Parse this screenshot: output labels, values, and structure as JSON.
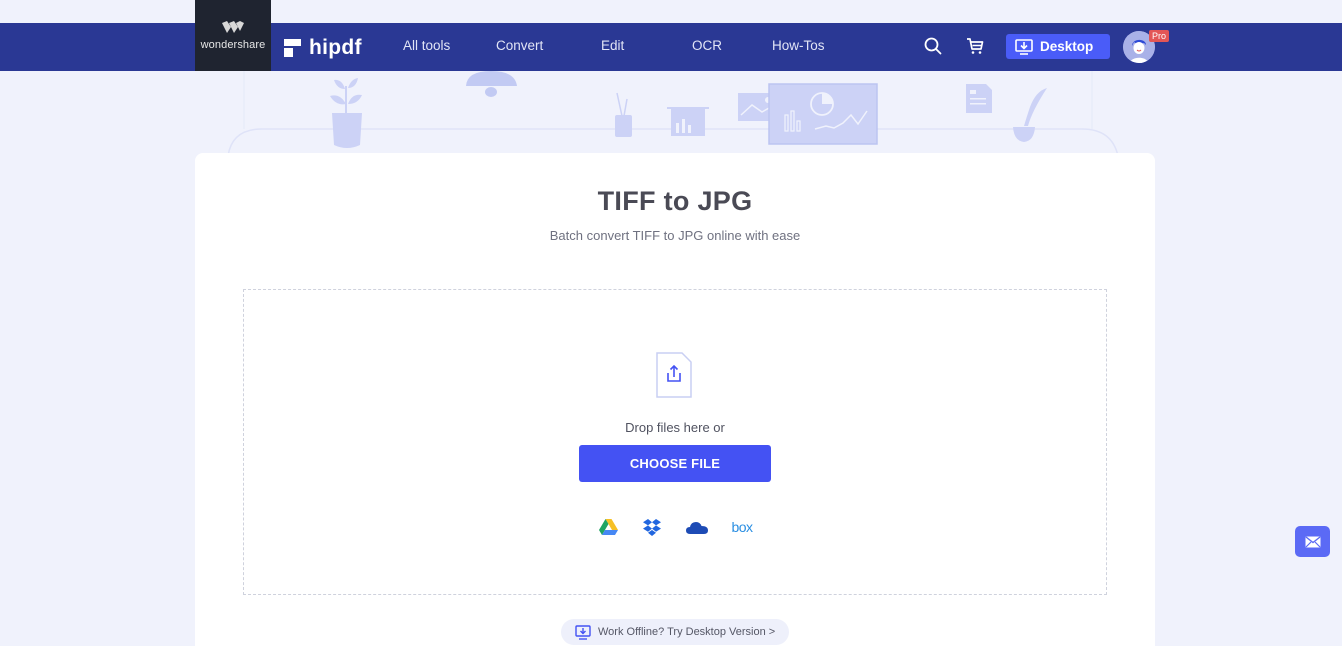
{
  "header": {
    "wondershare_label": "wondershare",
    "brand_label": "hipdf",
    "nav": [
      {
        "label": "All tools"
      },
      {
        "label": "Convert"
      },
      {
        "label": "Edit"
      },
      {
        "label": "OCR"
      },
      {
        "label": "How-Tos"
      }
    ],
    "desktop_label": "Desktop",
    "pro_badge": "Pro",
    "icons": [
      "search-icon",
      "cart-icon",
      "desktop-download-icon",
      "avatar"
    ]
  },
  "main": {
    "title": "TIFF to JPG",
    "subtitle": "Batch convert TIFF to JPG online with ease",
    "drop_text": "Drop files here or",
    "choose_label": "CHOOSE FILE",
    "cloud_sources": [
      {
        "name": "google-drive",
        "label": ""
      },
      {
        "name": "dropbox",
        "label": ""
      },
      {
        "name": "onedrive",
        "label": ""
      },
      {
        "name": "box",
        "label": "box"
      }
    ],
    "offline_label": "Work Offline? Try Desktop Version >"
  },
  "colors": {
    "nav_bg": "#2a3894",
    "accent": "#4452f3",
    "page_bg": "#f0f2fc"
  }
}
